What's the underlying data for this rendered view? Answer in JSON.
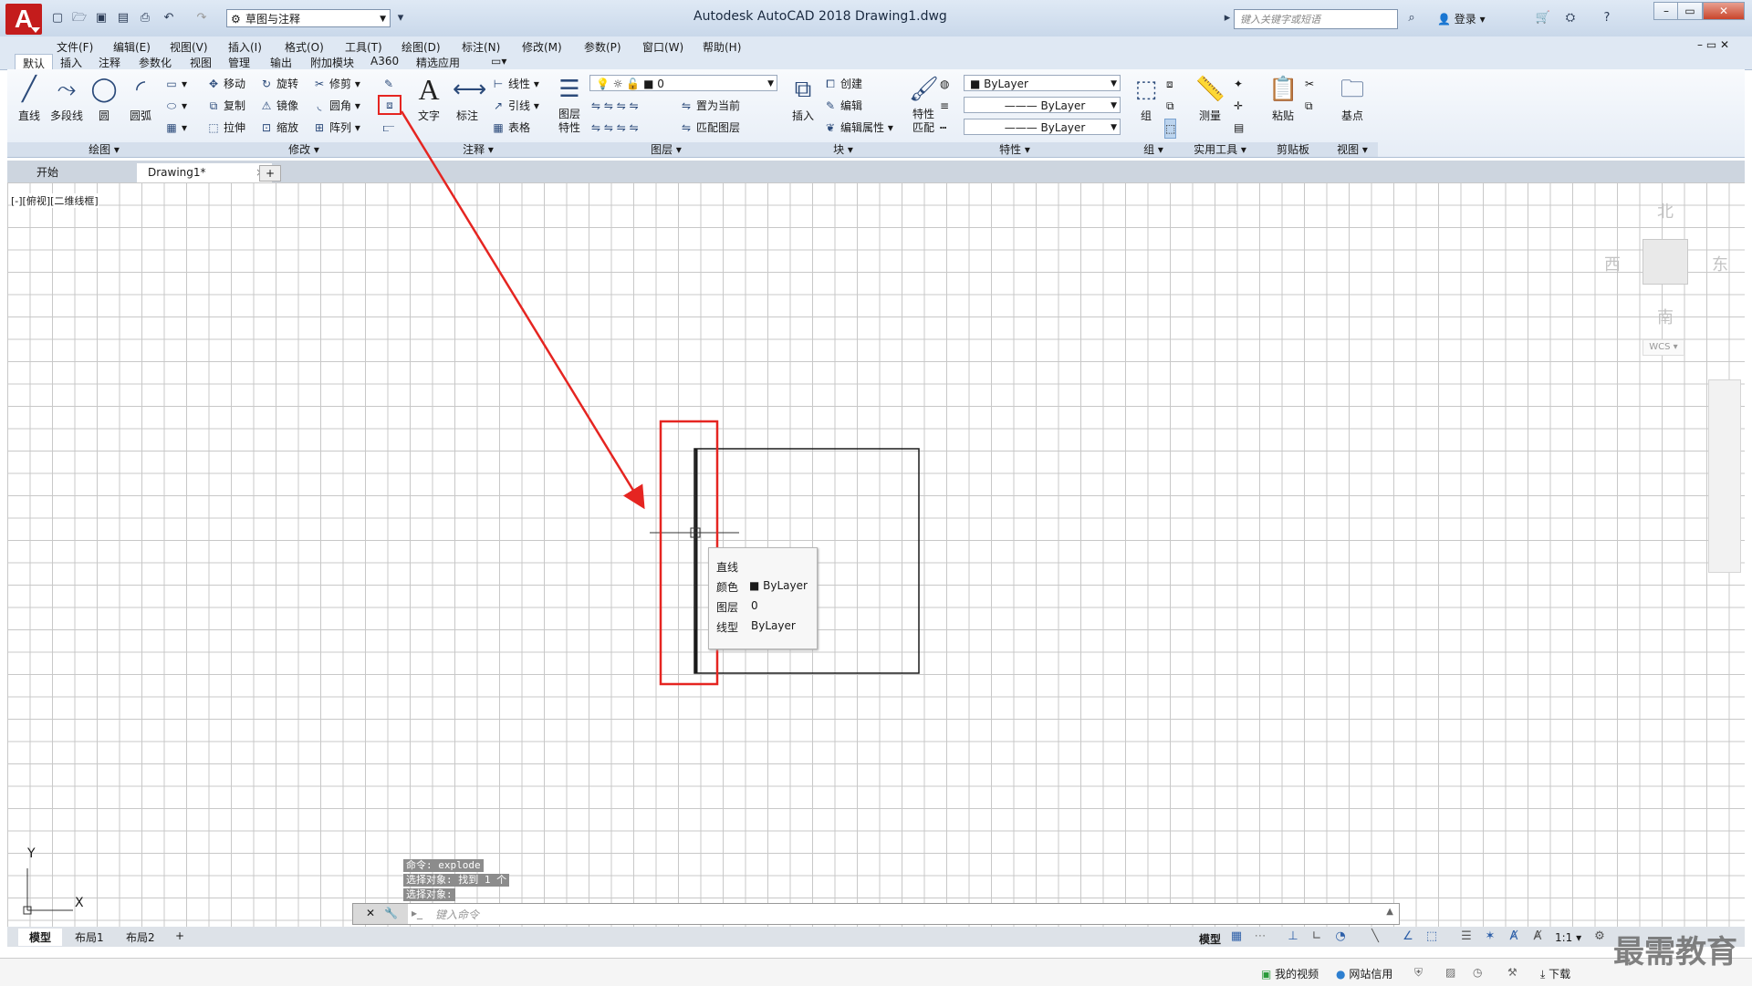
{
  "app": {
    "logo_letter": "A",
    "title": "Autodesk AutoCAD 2018    Drawing1.dwg",
    "workspace": "草图与注释",
    "search_placeholder": "键入关键字或短语",
    "login": "登录"
  },
  "window_controls": {
    "minimize": "–",
    "restore": "▭",
    "close": "✕"
  },
  "menu": [
    "文件(F)",
    "编辑(E)",
    "视图(V)",
    "插入(I)",
    "格式(O)",
    "工具(T)",
    "绘图(D)",
    "标注(N)",
    "修改(M)",
    "参数(P)",
    "窗口(W)",
    "帮助(H)"
  ],
  "ribbon_tabs": [
    "默认",
    "插入",
    "注释",
    "参数化",
    "视图",
    "管理",
    "输出",
    "附加模块",
    "A360",
    "精选应用"
  ],
  "draw_panel": {
    "title": "绘图",
    "line": "直线",
    "polyline": "多段线",
    "circle": "圆",
    "arc": "圆弧"
  },
  "modify_panel": {
    "title": "修改",
    "move": "移动",
    "rotate": "旋转",
    "trim": "修剪",
    "copy": "复制",
    "mirror": "镜像",
    "fillet": "圆角",
    "stretch": "拉伸",
    "scale": "缩放",
    "array": "阵列"
  },
  "annotation_panel": {
    "title": "注释",
    "text": "文字",
    "dimension": "标注",
    "linear": "线性",
    "leader": "引线",
    "table": "表格"
  },
  "layers_panel": {
    "title": "图层",
    "properties": "图层\n特性",
    "current_layer": "0",
    "set_current": "置为当前",
    "match": "匹配图层"
  },
  "block_panel": {
    "title": "块",
    "insert": "插入",
    "create": "创建",
    "edit": "编辑",
    "edit_attr": "编辑属性"
  },
  "properties_panel": {
    "title": "特性",
    "match": "特性\n匹配",
    "color": "ByLayer",
    "linetype": "ByLayer",
    "lineweight": "ByLayer"
  },
  "group_panel": {
    "title": "组",
    "group": "组"
  },
  "utilities_panel": {
    "title": "实用工具",
    "measure": "测量"
  },
  "clipboard_panel": {
    "title": "剪贴板",
    "paste": "粘贴"
  },
  "view_panel": {
    "title": "视图",
    "base": "基点"
  },
  "doc_tabs": {
    "start": "开始",
    "drawing": "Drawing1*",
    "add": "+"
  },
  "viewport_label": "[-][俯视][二维线框]",
  "viewcube": {
    "north": "北",
    "south": "南",
    "east": "东",
    "west": "西",
    "wcs": "WCS"
  },
  "tooltip": {
    "title": "直线",
    "color_label": "颜色",
    "color_value": "ByLayer",
    "layer_label": "图层",
    "layer_value": "0",
    "linetype_label": "线型",
    "linetype_value": "ByLayer"
  },
  "command_history": [
    "命令:  explode",
    "选择对象: 找到 1 个",
    "选择对象:"
  ],
  "command_placeholder": "键入命令",
  "ucs": {
    "x": "X",
    "y": "Y"
  },
  "layout_tabs": [
    "模型",
    "布局1",
    "布局2",
    "+"
  ],
  "status": {
    "model": "模型",
    "scale": "1:1"
  },
  "taskbar": {
    "video": "我的视频",
    "credit": "网站信用",
    "download": "下载"
  },
  "watermark": "最需教育"
}
